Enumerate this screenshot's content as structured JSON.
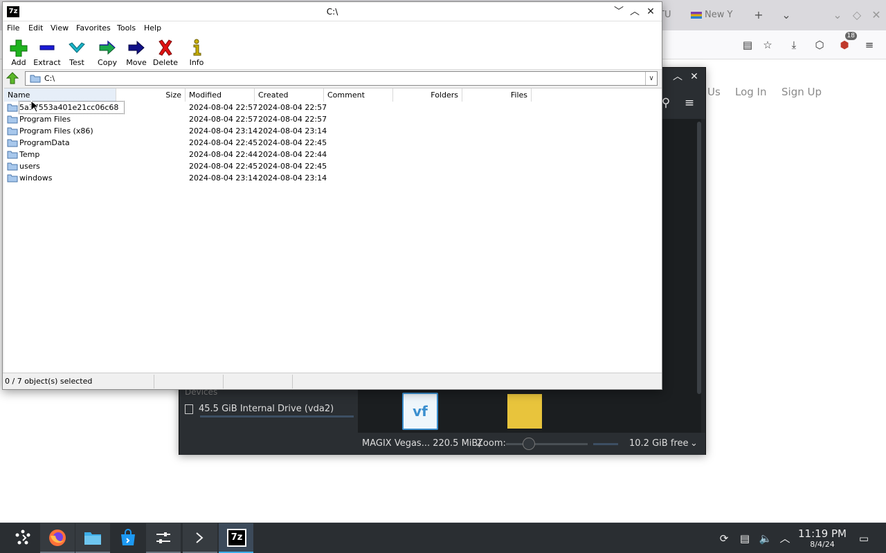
{
  "browser": {
    "tabs": [
      {
        "label": "TU"
      },
      {
        "label": "New Y"
      }
    ],
    "site_links": [
      "Us",
      "Log In",
      "Sign Up"
    ],
    "extension_badge": "18"
  },
  "file_manager": {
    "devices_heading": "Devices",
    "drive_label": "45.5 GiB Internal Drive (vda2)",
    "file_icon_text": "vf",
    "status_file": "MAGIX Vegas... 220.5 MiB)",
    "zoom_label": "Zoom:",
    "free_space": "10.2 GiB free"
  },
  "sevenzip": {
    "logo_text": "7z",
    "title": "C:\\",
    "menu": [
      "File",
      "Edit",
      "View",
      "Favorites",
      "Tools",
      "Help"
    ],
    "toolbar": [
      {
        "label": "Add",
        "icon": "plus-icon",
        "color": "#1fb31f"
      },
      {
        "label": "Extract",
        "icon": "minus-icon",
        "color": "#1a1ad6"
      },
      {
        "label": "Test",
        "icon": "check-icon",
        "color": "#19b3c7"
      },
      {
        "label": "Copy",
        "icon": "arrow-right-icon",
        "color": "#1aa84d"
      },
      {
        "label": "Move",
        "icon": "arrow-right-icon",
        "color": "#111188"
      },
      {
        "label": "Delete",
        "icon": "x-icon",
        "color": "#e01212"
      },
      {
        "label": "Info",
        "icon": "info-icon",
        "color": "#c8b000"
      }
    ],
    "address": "C:\\",
    "columns": [
      "Name",
      "Size",
      "Modified",
      "Created",
      "Comment",
      "Folders",
      "Files"
    ],
    "rows": [
      {
        "name": "5a​37553a401e21cc06c68",
        "modified": "2024-08-04 22:57",
        "created": "2024-08-04 22:57"
      },
      {
        "name": "Program Files",
        "modified": "2024-08-04 22:57",
        "created": "2024-08-04 22:57"
      },
      {
        "name": "Program Files (x86)",
        "modified": "2024-08-04 23:14",
        "created": "2024-08-04 23:14"
      },
      {
        "name": "ProgramData",
        "modified": "2024-08-04 22:45",
        "created": "2024-08-04 22:45"
      },
      {
        "name": "Temp",
        "modified": "2024-08-04 22:44",
        "created": "2024-08-04 22:44"
      },
      {
        "name": "users",
        "modified": "2024-08-04 22:45",
        "created": "2024-08-04 22:45"
      },
      {
        "name": "windows",
        "modified": "2024-08-04 23:14",
        "created": "2024-08-04 23:14"
      }
    ],
    "status": "0 / 7 object(s) selected"
  },
  "taskbar": {
    "time": "11:19 PM",
    "date": "8/4/24",
    "app_logo_text": "7z"
  }
}
